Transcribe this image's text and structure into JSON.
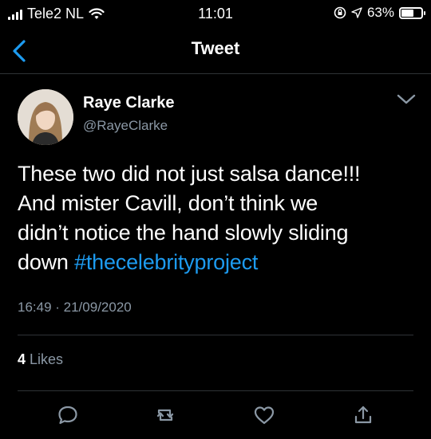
{
  "status_bar": {
    "carrier": "Tele2 NL",
    "time": "11:01",
    "battery": "63%",
    "battery_level": 0.63
  },
  "nav": {
    "title": "Tweet"
  },
  "tweet": {
    "author_name": "Raye Clarke",
    "author_handle": "@RayeClarke",
    "text_lines": [
      "These two did not just salsa dance!!!",
      "And mister Cavill, don’t think we",
      "didn’t notice the hand slowly sliding",
      "down "
    ],
    "hashtag": "#thecelebrityproject",
    "timestamp": "16:49 · 21/09/2020",
    "likes_count": "4",
    "likes_label": " Likes"
  },
  "colors": {
    "background": "#000000",
    "link": "#1d9bf0",
    "muted": "#8b98a5",
    "divider": "#2f3336"
  },
  "icons": [
    "back-chevron-icon",
    "caret-down-icon",
    "reply-icon",
    "retweet-icon",
    "like-icon",
    "share-icon"
  ]
}
